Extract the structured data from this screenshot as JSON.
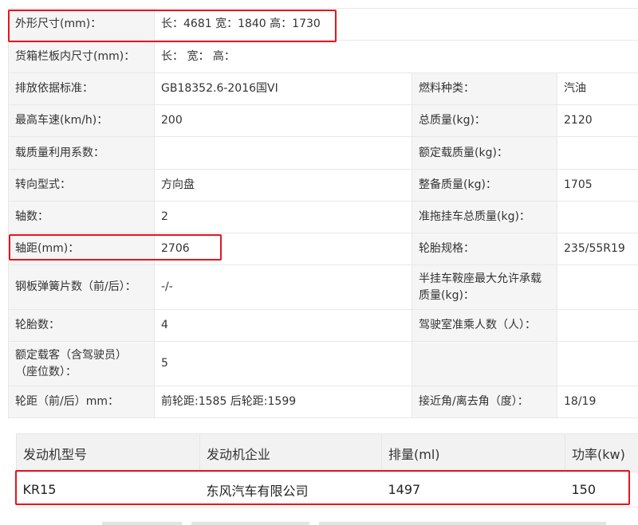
{
  "spec": {
    "dimensions": {
      "label": "外形尺寸(mm)：",
      "value": "长：4681 宽：1840 高：1730"
    },
    "cargo_box": {
      "label": "货箱栏板内尺寸(mm)：",
      "value": "长：  宽：  高："
    },
    "emission": {
      "label": "排放依据标准：",
      "value": "GB18352.6-2016国VI"
    },
    "fuel": {
      "label": "燃料种类：",
      "value": "汽油"
    },
    "max_speed": {
      "label": "最高车速(km/h)：",
      "value": "200"
    },
    "total_mass": {
      "label": "总质量(kg)：",
      "value": "2120"
    },
    "load_util": {
      "label": "载质量利用系数：",
      "value": ""
    },
    "rated_load": {
      "label": "额定载质量(kg)：",
      "value": ""
    },
    "steering": {
      "label": "转向型式：",
      "value": "方向盘"
    },
    "curb_mass": {
      "label": "整备质量(kg)：",
      "value": "1705"
    },
    "axles": {
      "label": "轴数：",
      "value": "2"
    },
    "trailer_mass": {
      "label": "准拖挂车总质量(kg)：",
      "value": ""
    },
    "wheelbase": {
      "label": "轴距(mm)：",
      "value": "2706"
    },
    "tire_spec": {
      "label": "轮胎规格：",
      "value": "235/55R19"
    },
    "leaf_springs": {
      "label": "钢板弹簧片数（前/后）：",
      "value": "-/-"
    },
    "saddle_load": {
      "label_line1": "半挂车鞍座最大允许承载",
      "label_line2": "质量(kg)：",
      "value": ""
    },
    "tire_count": {
      "label": "轮胎数：",
      "value": "4"
    },
    "cab_passengers": {
      "label": "驾驶室准乘人数（人）：",
      "value": ""
    },
    "seats": {
      "label_line1": "额定载客（含驾驶员）",
      "label_line2": "（座位数）：",
      "value": "5"
    },
    "track": {
      "label": "轮距（前/后）mm：",
      "value": "前轮距:1585 后轮距:1599"
    },
    "angles": {
      "label": "接近角/离去角（度）：",
      "value": "18/19"
    }
  },
  "engine": {
    "headers": [
      "发动机型号",
      "发动机企业",
      "排量(ml)",
      "功率(kw)"
    ],
    "row": [
      "KR15",
      "东风汽车有限公司",
      "1497",
      "150"
    ]
  },
  "colors": {
    "highlight": "#e8141e",
    "label_bg": "#f5f5f5",
    "header_bg": "#f2f2f2"
  }
}
